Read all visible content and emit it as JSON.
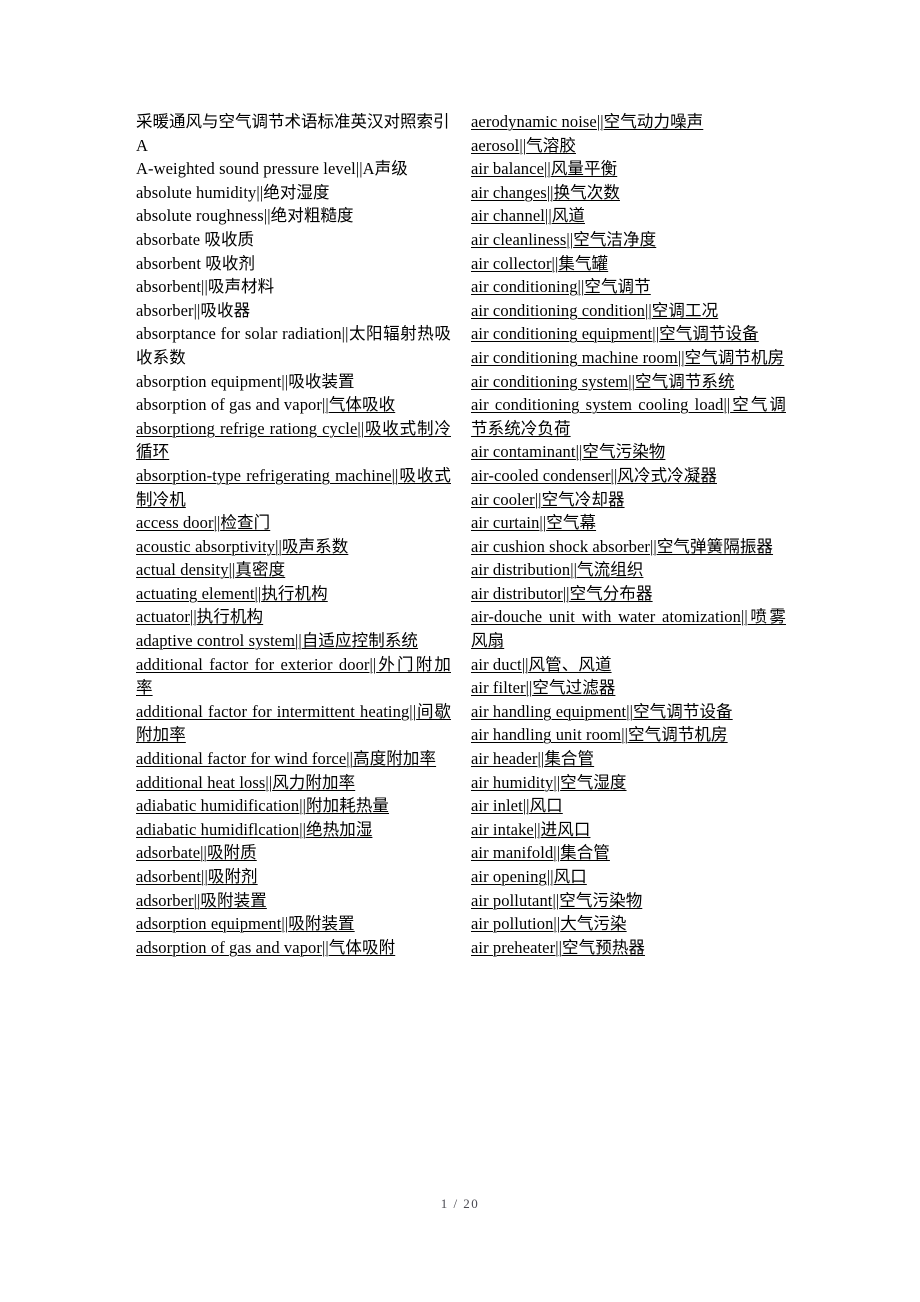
{
  "document": {
    "title": "采暖通风与空气调节术语标准英汉对照索引",
    "section_letter": "A",
    "footer": "1 / 20",
    "page_number": 1,
    "page_total": 20,
    "separator": "||"
  },
  "left_column": {
    "entries": [
      {
        "text": "采暖通风与空气调节术语标准英汉对照索引",
        "underline": "none",
        "type": "title"
      },
      {
        "text": "A",
        "underline": "none",
        "type": "letter"
      },
      {
        "text": "A-weighted sound pressure level||A声级",
        "underline": "none",
        "type": "entry"
      },
      {
        "text": "absolute humidity||绝对湿度",
        "underline": "none",
        "type": "entry"
      },
      {
        "text": "absolute roughness||绝对粗糙度",
        "underline": "none",
        "type": "entry"
      },
      {
        "text": "absorbate 吸收质",
        "underline": "none",
        "type": "entry"
      },
      {
        "text": "absorbent 吸收剂",
        "underline": "none",
        "type": "entry"
      },
      {
        "text": "absorbent||吸声材料",
        "underline": "none",
        "type": "entry"
      },
      {
        "text": "absorber||吸收器",
        "underline": "none",
        "type": "entry"
      },
      {
        "text": "absorptance for solar radiation||太阳辐射热吸收系数",
        "underline": "none",
        "type": "entry"
      },
      {
        "text": "absorption equipment||吸收装置",
        "underline": "none",
        "type": "entry"
      },
      {
        "text": "absorption of gas and vapor||气体吸收",
        "underline": "partial",
        "underline_from": "||气体吸收",
        "type": "entry"
      },
      {
        "text": "absorptiong    refrige    rationg cycle||吸收式制冷循环",
        "underline": "full",
        "type": "entry"
      },
      {
        "text": "absorption-type       refrigerating machine||吸收式制冷机",
        "underline": "full",
        "type": "entry"
      },
      {
        "text": "access door||检查门",
        "underline": "full",
        "type": "entry"
      },
      {
        "text": "acoustic absorptivity||吸声系数",
        "underline": "full",
        "type": "entry"
      },
      {
        "text": "actual density||真密度",
        "underline": "full",
        "type": "entry"
      },
      {
        "text": "actuating element||执行机构",
        "underline": "full",
        "type": "entry"
      },
      {
        "text": "actuator||执行机构",
        "underline": "full",
        "type": "entry"
      },
      {
        "text": "adaptive control system||自适应控制系统",
        "underline": "full",
        "type": "entry"
      },
      {
        "text": "additional  factor  for  exterior door||外门附加率",
        "underline": "full",
        "type": "entry"
      },
      {
        "text": "additional factor for intermittent heating||间歇附加率",
        "underline": "full",
        "type": "entry"
      },
      {
        "text": "additional factor for wind force||高度附加率",
        "underline": "full",
        "type": "entry"
      },
      {
        "text": "additional heat loss||风力附加率",
        "underline": "full",
        "type": "entry"
      },
      {
        "text": "adiabatic humidification||附加耗热量",
        "underline": "full",
        "type": "entry"
      },
      {
        "text": "adiabatic humidiflcation||绝热加湿",
        "underline": "full",
        "type": "entry"
      },
      {
        "text": "adsorbate||吸附质",
        "underline": "full",
        "type": "entry"
      },
      {
        "text": "adsorbent||吸附剂",
        "underline": "full",
        "type": "entry"
      },
      {
        "text": "adsorber||吸附装置",
        "underline": "full",
        "type": "entry"
      },
      {
        "text": "adsorption equipment||吸附装置",
        "underline": "full",
        "type": "entry"
      },
      {
        "text": "adsorption of gas and vapor||气体吸附",
        "underline": "full",
        "type": "entry"
      }
    ]
  },
  "right_column": {
    "entries": [
      {
        "text": "aerodynamic noise||空气动力噪声",
        "underline": "full",
        "type": "entry"
      },
      {
        "text": "aerosol||气溶胶",
        "underline": "full",
        "type": "entry"
      },
      {
        "text": "air balance||风量平衡",
        "underline": "full",
        "type": "entry"
      },
      {
        "text": "air changes||换气次数",
        "underline": "full",
        "type": "entry"
      },
      {
        "text": "air channel||风道",
        "underline": "full",
        "type": "entry"
      },
      {
        "text": "air cleanliness||空气洁净度",
        "underline": "full",
        "type": "entry"
      },
      {
        "text": "air collector||集气罐",
        "underline": "full",
        "type": "entry"
      },
      {
        "text": "air conditioning||空气调节",
        "underline": "full",
        "type": "entry"
      },
      {
        "text": "air conditioning condition||空调工况",
        "underline": "full",
        "type": "entry"
      },
      {
        "text": "air conditioning equipment||空气调节设备",
        "underline": "full",
        "type": "entry"
      },
      {
        "text": "air conditioning machine room||空气调节机房",
        "underline": "full",
        "type": "entry"
      },
      {
        "text": "air conditioning system||空气调节系统",
        "underline": "full",
        "type": "entry"
      },
      {
        "text": "air  conditioning  system  cooling load||空气调节系统冷负荷",
        "underline": "full",
        "type": "entry"
      },
      {
        "text": "air contaminant||空气污染物",
        "underline": "full",
        "type": "entry"
      },
      {
        "text": "air-cooled condenser||风冷式冷凝器",
        "underline": "full",
        "type": "entry"
      },
      {
        "text": "air cooler||空气冷却器",
        "underline": "full",
        "type": "entry"
      },
      {
        "text": "air curtain||空气幕",
        "underline": "full",
        "type": "entry"
      },
      {
        "text": "air cushion shock absorber||空气弹簧隔振器",
        "underline": "full",
        "type": "entry"
      },
      {
        "text": "air distribution||气流组织",
        "underline": "full",
        "type": "entry"
      },
      {
        "text": "air distributor||空气分布器",
        "underline": "full",
        "type": "entry"
      },
      {
        "text": "air-douche   unit   with   water atomization||喷雾风扇",
        "underline": "full",
        "type": "entry"
      },
      {
        "text": "air duct||风管、风道",
        "underline": "full",
        "type": "entry"
      },
      {
        "text": "air filter||空气过滤器",
        "underline": "full",
        "type": "entry"
      },
      {
        "text": "air handling equipment||空气调节设备",
        "underline": "full",
        "type": "entry"
      },
      {
        "text": "air handling unit room||空气调节机房",
        "underline": "full",
        "type": "entry"
      },
      {
        "text": "air header||集合管",
        "underline": "full",
        "type": "entry"
      },
      {
        "text": "air humidity||空气湿度",
        "underline": "full",
        "type": "entry"
      },
      {
        "text": "air inlet||风口",
        "underline": "full",
        "type": "entry"
      },
      {
        "text": "air intake||进风口",
        "underline": "full",
        "type": "entry"
      },
      {
        "text": "air manifold||集合管",
        "underline": "full",
        "type": "entry"
      },
      {
        "text": "air opening||风口",
        "underline": "full",
        "type": "entry"
      },
      {
        "text": "air pollutant||空气污染物",
        "underline": "full",
        "type": "entry"
      },
      {
        "text": "air pollution||大气污染",
        "underline": "full",
        "type": "entry"
      },
      {
        "text": "air preheater||空气预热器",
        "underline": "full",
        "type": "entry"
      }
    ]
  },
  "colors": {
    "page_background": "#ffffff",
    "text": "#000000",
    "footer_text": "#4a4a52"
  }
}
